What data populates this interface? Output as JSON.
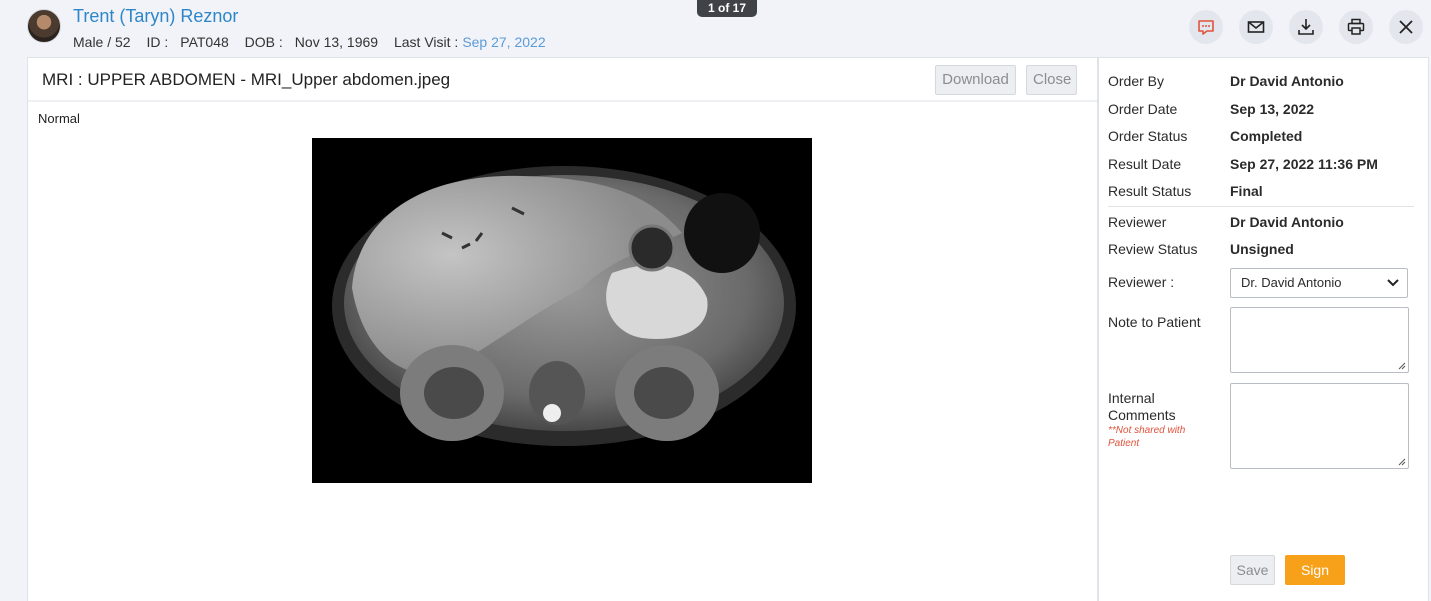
{
  "patient": {
    "name": "Trent (Taryn) Reznor",
    "gender_age": "Male / 52",
    "id_label": "ID :",
    "id_value": "PAT048",
    "dob_label": "DOB :",
    "dob_value": "Nov 13, 1969",
    "last_visit_label": "Last Visit :",
    "last_visit_value": "Sep 27, 2022"
  },
  "pager": {
    "text": "1 of 17"
  },
  "header_actions": [
    {
      "icon": "chat-icon"
    },
    {
      "icon": "mail-icon"
    },
    {
      "icon": "download-icon"
    },
    {
      "icon": "print-icon"
    },
    {
      "icon": "close-icon"
    }
  ],
  "document": {
    "title": "MRI : UPPER ABDOMEN - MRI_Upper abdomen.jpeg",
    "download_label": "Download",
    "close_label": "Close",
    "result_note": "Normal"
  },
  "details": {
    "order_by_label": "Order By",
    "order_by_value": "Dr David Antonio",
    "order_date_label": "Order Date",
    "order_date_value": "Sep 13, 2022",
    "order_status_label": "Order Status",
    "order_status_value": "Completed",
    "result_date_label": "Result Date",
    "result_date_value": "Sep 27, 2022 11:36 PM",
    "result_status_label": "Result Status",
    "result_status_value": "Final",
    "reviewer_label": "Reviewer",
    "reviewer_value": "Dr David Antonio",
    "review_status_label": "Review Status",
    "review_status_value": "Unsigned"
  },
  "review_form": {
    "reviewer_select_label": "Reviewer :",
    "reviewer_selected": "Dr. David Antonio",
    "note_label": "Note to Patient",
    "note_value": "",
    "internal_label": "Internal Comments",
    "internal_hint": "**Not shared with Patient",
    "internal_value": "",
    "save_label": "Save",
    "sign_label": "Sign"
  },
  "colors": {
    "accent": "#2d86c9",
    "sign_button": "#f7a01a",
    "warning_text": "#e0533c"
  }
}
